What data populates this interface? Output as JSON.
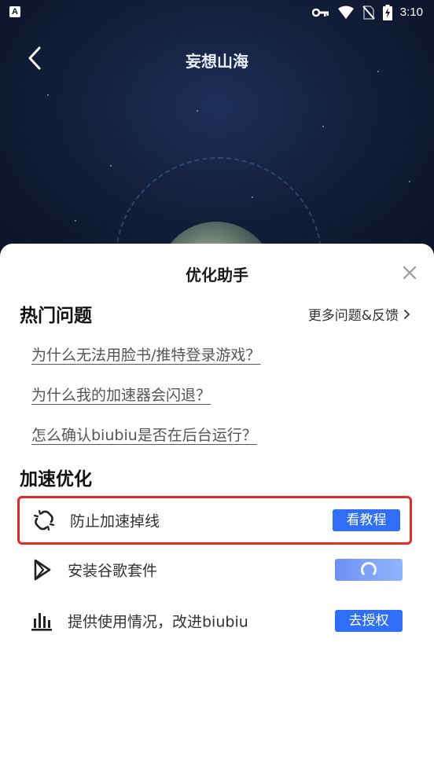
{
  "status_bar": {
    "left_icon": "A",
    "time": "3:10",
    "icons": [
      "key-icon",
      "wifi-icon",
      "no-sim-icon",
      "battery-charging-icon"
    ]
  },
  "header": {
    "title": "妄想山海",
    "back_icon": "chevron-left-icon"
  },
  "sheet": {
    "title": "优化助手",
    "close_icon": "close-icon",
    "hot_questions": {
      "title": "热门问题",
      "more_label": "更多问题&反馈",
      "items": [
        "为什么无法用脸书/推特登录游戏？",
        "为什么我的加速器会闪退？",
        "怎么确认biubiu是否在后台运行？"
      ]
    },
    "optimization": {
      "title": "加速优化",
      "items": [
        {
          "icon": "broken-link-icon",
          "label": "防止加速掉线",
          "button": "看教程",
          "highlighted": true
        },
        {
          "icon": "play-triangle-icon",
          "label": "安装谷歌套件",
          "button": "",
          "loading": true
        },
        {
          "icon": "bar-chart-icon",
          "label": "提供使用情况，改进biubiu",
          "button": "去授权"
        }
      ]
    }
  },
  "colors": {
    "accent": "#2f6ef5",
    "highlight_border": "#e52a2a",
    "bg_dark": "#141f3c"
  }
}
